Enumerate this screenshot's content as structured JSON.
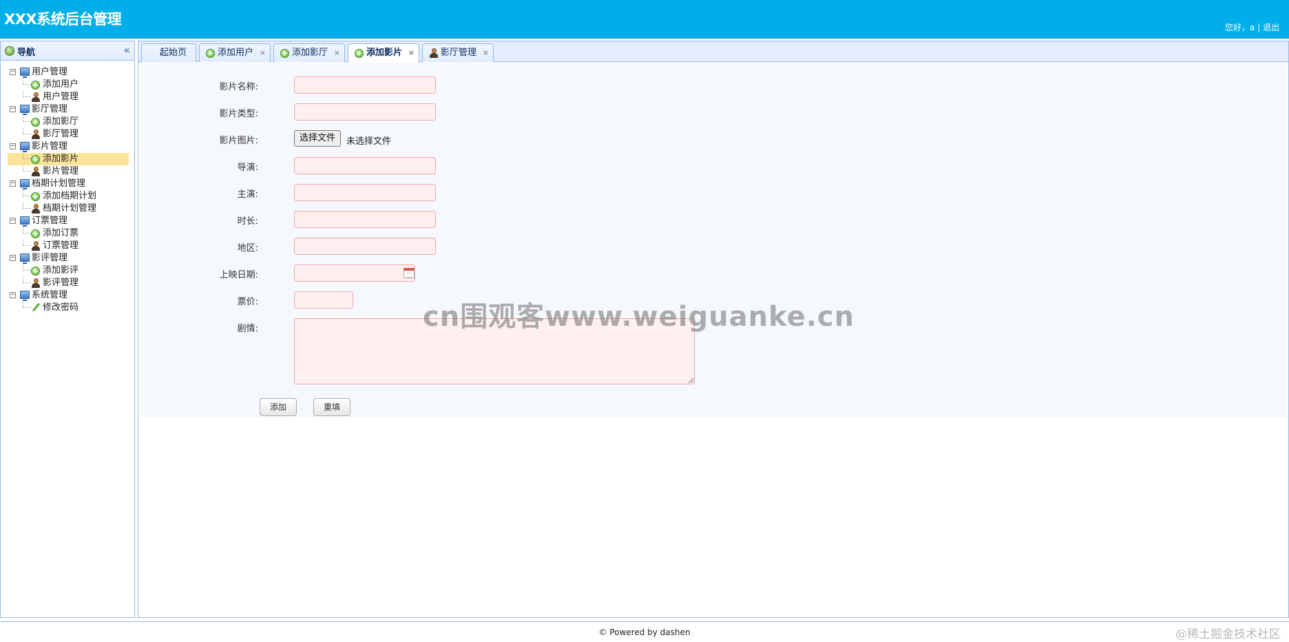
{
  "header": {
    "title": "XXX系统后台管理",
    "greeting": "您好，a",
    "separator": "|",
    "logout": "退出",
    "bg_color": "#00aeea"
  },
  "sidebar": {
    "title": "导航",
    "collapse_icon": "«",
    "groups": [
      {
        "label": "用户管理",
        "children": [
          {
            "label": "添加用户",
            "icon": "add-icon"
          },
          {
            "label": "用户管理",
            "icon": "user-icon"
          }
        ]
      },
      {
        "label": "影厅管理",
        "children": [
          {
            "label": "添加影厅",
            "icon": "add-icon"
          },
          {
            "label": "影厅管理",
            "icon": "user-icon"
          }
        ]
      },
      {
        "label": "影片管理",
        "children": [
          {
            "label": "添加影片",
            "icon": "add-icon",
            "selected": true
          },
          {
            "label": "影片管理",
            "icon": "user-icon"
          }
        ]
      },
      {
        "label": "档期计划管理",
        "children": [
          {
            "label": "添加档期计划",
            "icon": "add-icon"
          },
          {
            "label": "档期计划管理",
            "icon": "user-icon"
          }
        ]
      },
      {
        "label": "订票管理",
        "children": [
          {
            "label": "添加订票",
            "icon": "add-icon"
          },
          {
            "label": "订票管理",
            "icon": "user-icon"
          }
        ]
      },
      {
        "label": "影评管理",
        "children": [
          {
            "label": "添加影评",
            "icon": "add-icon"
          },
          {
            "label": "影评管理",
            "icon": "user-icon"
          }
        ]
      },
      {
        "label": "系统管理",
        "children": [
          {
            "label": "修改密码",
            "icon": "pen-icon"
          }
        ]
      }
    ]
  },
  "tabs": [
    {
      "label": "起始页",
      "icon": "",
      "closable": false,
      "active": false
    },
    {
      "label": "添加用户",
      "icon": "add-icon",
      "closable": true,
      "active": false
    },
    {
      "label": "添加影厅",
      "icon": "add-icon",
      "closable": true,
      "active": false
    },
    {
      "label": "添加影片",
      "icon": "add-icon",
      "closable": true,
      "active": true
    },
    {
      "label": "影厅管理",
      "icon": "user-icon",
      "closable": true,
      "active": false
    }
  ],
  "tab_close_glyph": "×",
  "form": {
    "name_label": "影片名称:",
    "type_label": "影片类型:",
    "image_label": "影片图片:",
    "file_button": "选择文件",
    "file_status": "未选择文件",
    "director_label": "导演:",
    "actor_label": "主演:",
    "duration_label": "时长:",
    "region_label": "地区:",
    "release_label": "上映日期:",
    "price_label": "票价:",
    "plot_label": "剧情:",
    "submit_button": "添加",
    "reset_button": "重填"
  },
  "watermark": "cn围观客www.weiguanke.cn",
  "footer": {
    "copyright": "© Powered by dashen",
    "site_mark": "@稀土掘金技术社区"
  }
}
